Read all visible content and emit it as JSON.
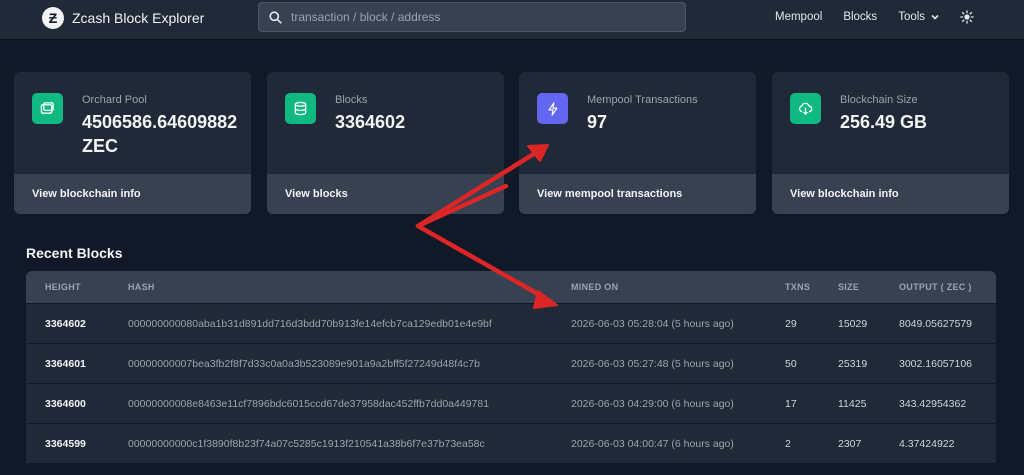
{
  "nav": {
    "logo_glyph": "Ƶ",
    "title": "Zcash Block Explorer",
    "search_placeholder": "transaction / block / address",
    "links": [
      "Mempool",
      "Blocks",
      "Tools"
    ]
  },
  "cards": [
    {
      "label": "Orchard Pool",
      "value": "4506586.64609882 ZEC",
      "footer": "View blockchain info",
      "icon": "wallet-icon",
      "color": "#10b981"
    },
    {
      "label": "Blocks",
      "value": "3364602",
      "footer": "View blocks",
      "icon": "database-icon",
      "color": "#10b981"
    },
    {
      "label": "Mempool Transactions",
      "value": "97",
      "footer": "View mempool transactions",
      "icon": "lightning-icon",
      "color": "#6366f1"
    },
    {
      "label": "Blockchain Size",
      "value": "256.49 GB",
      "footer": "View blockchain info",
      "icon": "cloud-download-icon",
      "color": "#10b981"
    }
  ],
  "recent_blocks": {
    "title": "Recent Blocks",
    "headers": [
      "HEIGHT",
      "HASH",
      "MINED ON",
      "TXNS",
      "SIZE",
      "OUTPUT ( ZEC )"
    ],
    "rows": [
      {
        "height": "3364602",
        "hash": "000000000080aba1b31d891dd716d3bdd70b913fe14efcb7ca129edb01e4e9bf",
        "mined": "2026-06-03 05:28:04 (5 hours ago)",
        "txns": "29",
        "size": "15029",
        "output": "8049.05627579"
      },
      {
        "height": "3364601",
        "hash": "00000000007bea3fb2f8f7d33c0a0a3b523089e901a9a2bff5f27249d48f4c7b",
        "mined": "2026-06-03 05:27:48 (5 hours ago)",
        "txns": "50",
        "size": "25319",
        "output": "3002.16057106"
      },
      {
        "height": "3364600",
        "hash": "00000000008e8463e11cf7896bdc6015ccd67de37958dac452ffb7dd0a449781",
        "mined": "2026-06-03 04:29:00 (6 hours ago)",
        "txns": "17",
        "size": "11425",
        "output": "343.42954362"
      },
      {
        "height": "3364599",
        "hash": "00000000000c1f3890f8b23f74a07c5285c1913f210541a38b6f7e37b73ea58c",
        "mined": "2026-06-03 04:00:47 (6 hours ago)",
        "txns": "2",
        "size": "2307",
        "output": "4.37424922"
      }
    ]
  },
  "colors": {
    "annotation_arrow": "#dc2626"
  }
}
